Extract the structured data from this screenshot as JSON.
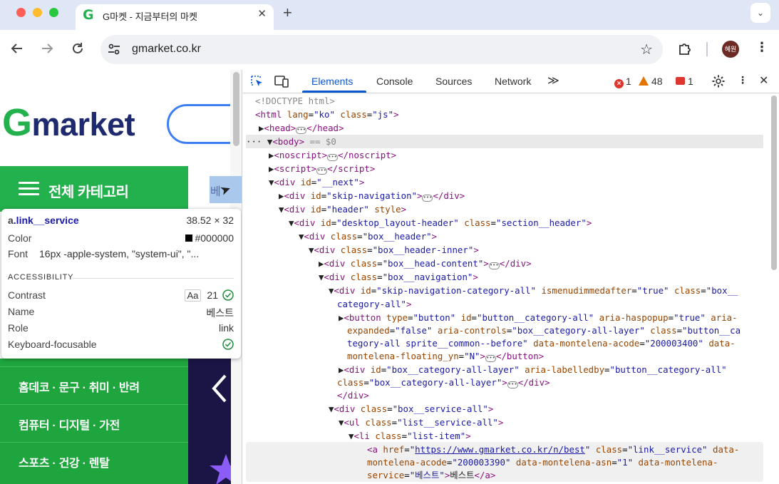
{
  "browser": {
    "tab_title": "G마켓 - 지금부터의 마켓",
    "tab_favicon": "G",
    "tab_close": "✕",
    "new_tab": "+",
    "tab_menu": "⌄",
    "url": "gmarket.co.kr",
    "avatar_text": "혜원"
  },
  "page": {
    "logo_g": "G",
    "logo_rest": "market",
    "category_all": "전체 카테고리",
    "best_link": "베",
    "sidebar_items": [
      "홈데코 · 문구 · 취미 · 반려",
      "컴퓨터 · 디지털 · 가전",
      "스포츠 · 건강 · 렌탈"
    ]
  },
  "tooltip": {
    "selector_tag": "a",
    "selector_class": ".link__service",
    "size": "38.52 × 32",
    "color_label": "Color",
    "color_value": "#000000",
    "font_label": "Font",
    "font_value": "16px -apple-system, \"system-ui\", \"...",
    "accessibility_heading": "ACCESSIBILITY",
    "contrast_label": "Contrast",
    "contrast_badge": "Aa",
    "contrast_value": "21",
    "name_label": "Name",
    "name_value": "베스트",
    "role_label": "Role",
    "role_value": "link",
    "keyboard_label": "Keyboard-focusable"
  },
  "devtools": {
    "tabs": [
      "Elements",
      "Console",
      "Sources",
      "Network"
    ],
    "more_tabs": "≫",
    "errors": "1",
    "warnings": "48",
    "issues": "1"
  },
  "colors": {
    "gmarket_green": "#23b14d",
    "devtools_accent": "#0b57d0",
    "tag_color": "#881280",
    "attr_name_color": "#994500",
    "attr_value_color": "#1a1aa6"
  }
}
